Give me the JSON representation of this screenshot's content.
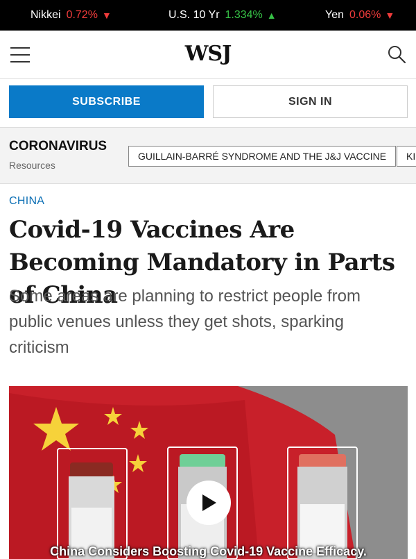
{
  "ticker": [
    {
      "name": "Nikkei",
      "value": "0.72%",
      "direction": "down",
      "arrow": "▼"
    },
    {
      "name": "U.S. 10 Yr",
      "value": "1.334%",
      "direction": "up",
      "arrow": "▲"
    },
    {
      "name": "Yen",
      "value": "0.06%",
      "direction": "down",
      "arrow": "▼"
    }
  ],
  "header": {
    "logo": "WSJ",
    "menu_icon": "hamburger-menu-icon",
    "search_icon": "search-icon"
  },
  "auth": {
    "subscribe_label": "SUBSCRIBE",
    "signin_label": "SIGN IN"
  },
  "topic": {
    "title": "CORONAVIRUS",
    "subtitle": "Resources",
    "chips": [
      "GUILLAIN-BARRÉ SYNDROME AND THE J&J VACCINE",
      "KI"
    ]
  },
  "article": {
    "kicker": "CHINA",
    "headline": "Covid-19 Vaccines Are Becoming Mandatory in Parts of China",
    "dek": "Some areas are planning to restrict people from public venues unless they get shots, sparking criticism"
  },
  "video": {
    "caption": "China Considers Boosting Covid-19 Vaccine Efficacy.",
    "play_icon": "play-icon"
  },
  "colors": {
    "accent": "#0a7ac8",
    "kicker": "#0a6eb4",
    "down": "#ef3b3b",
    "up": "#36c146"
  }
}
